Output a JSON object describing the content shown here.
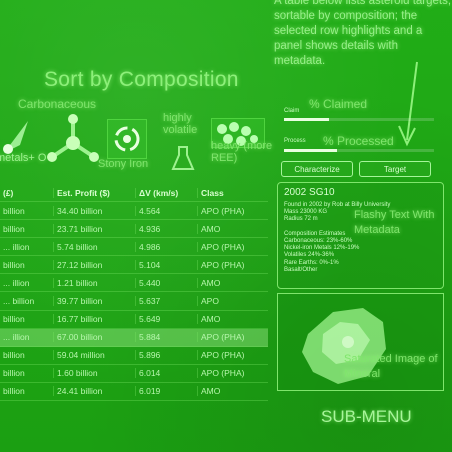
{
  "header": {
    "note": "A table below lists asteroid targets, sortable by composition; the selected row highlights and a panel shows details with metadata.",
    "title": "Sort by Composition"
  },
  "composition": {
    "carbonaceous": "Carbonaceous",
    "stony_iron": "Stony Iron",
    "volatile": "highly volatile",
    "heavy": "heavy (more REE)",
    "metal": "metals+ O"
  },
  "progress": {
    "claimed_label": "% Claimed",
    "claimed_bar_label": "Claim",
    "claimed_fraction": 0.3,
    "processed_label": "% Processed",
    "processed_bar_label": "Process",
    "processed_fraction": 0.35
  },
  "buttons": {
    "characterize": "Characterize",
    "target": "Target"
  },
  "table": {
    "headers": [
      "(£)",
      "Est. Profit ($)",
      "ΔV (km/s)",
      "Class"
    ],
    "rows": [
      [
        "billion",
        "34.40 billion",
        "4.564",
        "APO (PHA)"
      ],
      [
        "billion",
        "23.71 billion",
        "4.936",
        "AMO"
      ],
      [
        "... illion",
        "5.74 billion",
        "4.986",
        "APO (PHA)"
      ],
      [
        "billion",
        "27.12 billion",
        "5.104",
        "APO (PHA)"
      ],
      [
        "... illion",
        "1.21 billion",
        "5.440",
        "AMO"
      ],
      [
        "... billion",
        "39.77 billion",
        "5.637",
        "APO"
      ],
      [
        "billion",
        "16.77 billion",
        "5.649",
        "AMO"
      ],
      [
        "... illion",
        "67.00 billion",
        "5.884",
        "APO (PHA)"
      ],
      [
        "billion",
        "59.04 million",
        "5.896",
        "APO (PHA)"
      ],
      [
        "billion",
        "1.60 billion",
        "6.014",
        "APO (PHA)"
      ],
      [
        "billion",
        "24.41 billion",
        "6.019",
        "AMO"
      ]
    ],
    "highlighted_row": 7
  },
  "info": {
    "title": "2002 SG10",
    "lines": [
      "Found in 2002 by Rob at Billy University",
      "Mass 23000 KG",
      "Radius 72 m",
      "",
      "Composition Estimates",
      "Carbonaceous: 23%-60%",
      "Nickel-iron Metals 12%-19%",
      "Volatiles 24%-36%",
      "Rare Earths: 0%-1%",
      "Basalt/Other"
    ],
    "annotation": "Flashy Text With Metadata"
  },
  "image": {
    "annotation": "Saturated Image of Mineral"
  },
  "submenu": {
    "label": "SUB-MENU"
  }
}
